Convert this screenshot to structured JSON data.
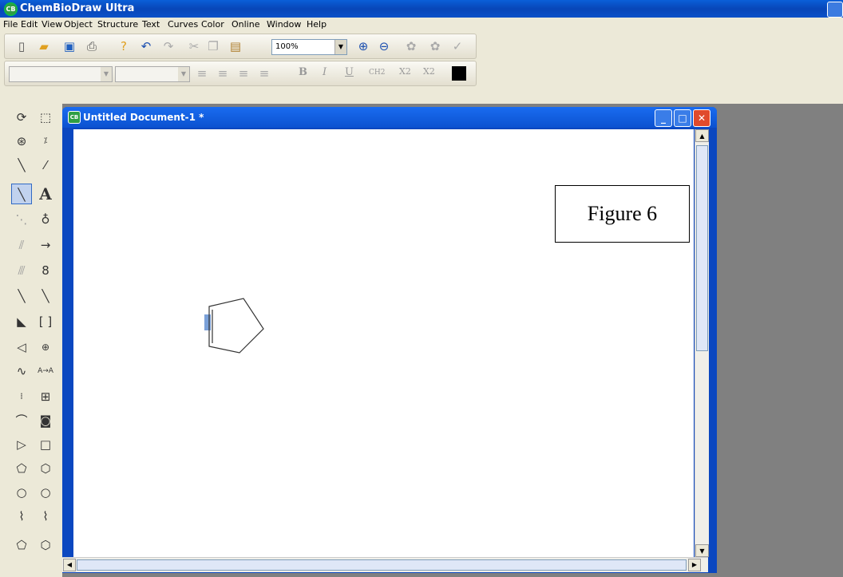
{
  "app": {
    "title": "ChemBioDraw Ultra",
    "icon": "chembiodraw-icon"
  },
  "menu": [
    "File",
    "Edit",
    "View",
    "Object",
    "Structure",
    "Text",
    "Curves",
    "Color",
    "Online",
    "Window",
    "Help"
  ],
  "toolbar": {
    "zoom": "100%",
    "buttons": [
      "new-icon",
      "open-icon",
      "save-icon",
      "print-icon",
      "help-icon",
      "undo-icon",
      "redo-icon",
      "cut-icon",
      "copy-icon",
      "paste-icon",
      "zoom-in-icon",
      "zoom-out-icon",
      "structure-to-name-icon",
      "name-to-structure-icon",
      "check-structure-icon"
    ]
  },
  "format_toolbar": {
    "font_name": "",
    "font_size": "",
    "bold": "B",
    "italic": "I",
    "underline": "U",
    "formula": "CH2",
    "subscript": "X2",
    "superscript": "X2",
    "color": "#000000"
  },
  "palette": {
    "tools": [
      "lasso-icon",
      "marquee-icon",
      "mass-fragment-icon",
      "mw-icon",
      "solid-bond-icon",
      "eraser-icon",
      "bold-bond-icon",
      "text-icon",
      "dashed-bond-icon",
      "orbital-icon",
      "hashed-bond-icon",
      "arrow-icon",
      "hashed-wedge-icon",
      "lone-pair-icon",
      "bold-line-icon",
      "plain-line-icon",
      "wedge-bond-icon",
      "bracket-icon",
      "hollow-wedge-icon",
      "charge-icon",
      "wavy-bond-icon",
      "atom-map-icon",
      "chain-icon",
      "table-icon",
      "polymer-icon",
      "template-icon",
      "triangle-icon",
      "square-icon",
      "pentagon-icon",
      "hexagon-icon",
      "heptagon-icon",
      "octagon-icon",
      "cyclohexane-chair-icon",
      "cyclohexane-chair-alt-icon",
      "cyclopentadiene-icon",
      "benzene-icon"
    ]
  },
  "document": {
    "title": "Untitled Document-1 *",
    "figure_label": "Figure 6"
  }
}
